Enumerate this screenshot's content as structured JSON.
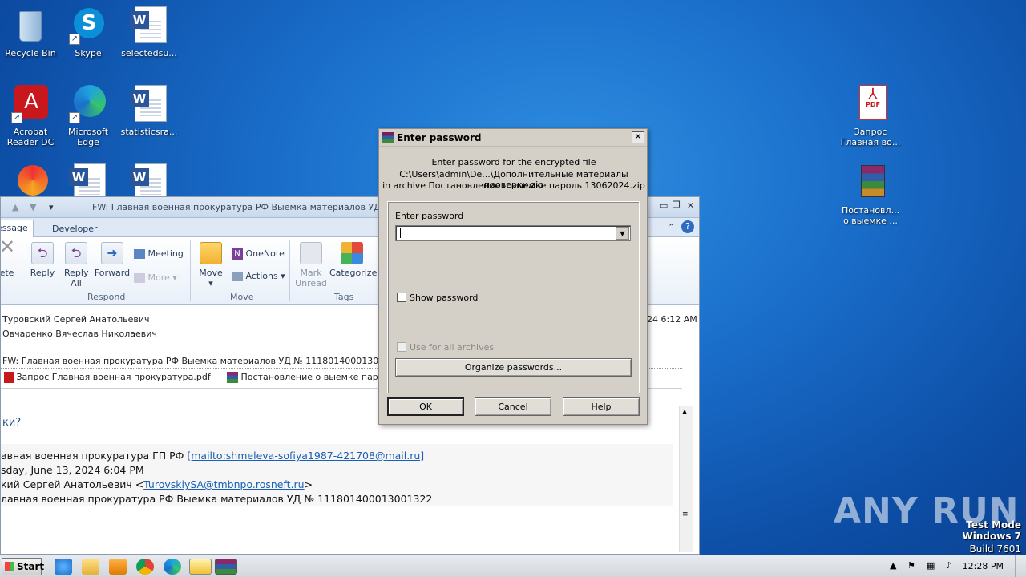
{
  "desktop": {
    "icons_left": [
      {
        "label": "Recycle Bin"
      },
      {
        "label": "Skype"
      },
      {
        "label": "selectedsu..."
      },
      {
        "label": "Acrobat Reader DC"
      },
      {
        "label": "Microsoft Edge"
      },
      {
        "label": "statisticsra..."
      }
    ],
    "icons_right": [
      {
        "label": "Запрос Главная во..."
      },
      {
        "label": "Постановл... о выемке ..."
      }
    ],
    "pdf_badge": "PDF"
  },
  "outlook": {
    "title": "FW: Главная военная прокуратура РФ Выемка материалов УД № 11",
    "tabs": [
      "essage",
      "Developer"
    ],
    "ribbon": {
      "buttons": [
        "lete",
        "Reply",
        "Reply All",
        "Forward",
        "Meeting",
        "More",
        "Move",
        "OneNote",
        "Actions",
        "Mark Unread",
        "Categorize"
      ],
      "groups": [
        "Respond",
        "Move",
        "Tags"
      ]
    },
    "from": "Туровский Сергей Анатольевич",
    "to": "Овчаренко Вячеслав Николаевич",
    "date": "24 6:12 AM",
    "subject": "FW: Главная военная прокуратура РФ Выемка материалов УД № 111801400013001322",
    "attachments": [
      "Запрос Главная военная прокуратура.pdf",
      "Постановление о выемке  парол"
    ],
    "body": {
      "line1": "ки?",
      "line2_prefix": "авная военная прокуратура ГП РФ ",
      "line2_link": "[mailto:shmeleva-sofiya1987-421708@mail.ru]",
      "line3": "sday, June 13, 2024 6:04 PM",
      "line4_prefix": "кий Сергей Анатольевич <",
      "line4_link": "TurovskiySA@tmbnpo.rosneft.ru",
      "line4_suffix": ">",
      "line5": "лавная военная прокуратура РФ Выемка материалов УД № 111801400013001322"
    }
  },
  "dialog": {
    "title": "Enter password",
    "message_line1": "Enter password for the encrypted file",
    "message_line2": "C:\\Users\\admin\\De...\\Дополнительные материалы проверки.zip",
    "message_line3": "in archive Постановление о выемке  пароль 13062024.zip",
    "field_label": "Enter password",
    "password_value": "",
    "show_password_label": "Show password",
    "use_all_label": "Use for all archives",
    "organize_label": "Organize passwords...",
    "ok_label": "OK",
    "cancel_label": "Cancel",
    "help_label": "Help",
    "close_glyph": "✕"
  },
  "taskbar": {
    "start_label": "Start",
    "clock": "12:28 PM"
  },
  "watermark": {
    "line1": "Test Mode",
    "line2": "Windows 7",
    "line3": "Build 7601",
    "brand": "ANY RUN"
  }
}
